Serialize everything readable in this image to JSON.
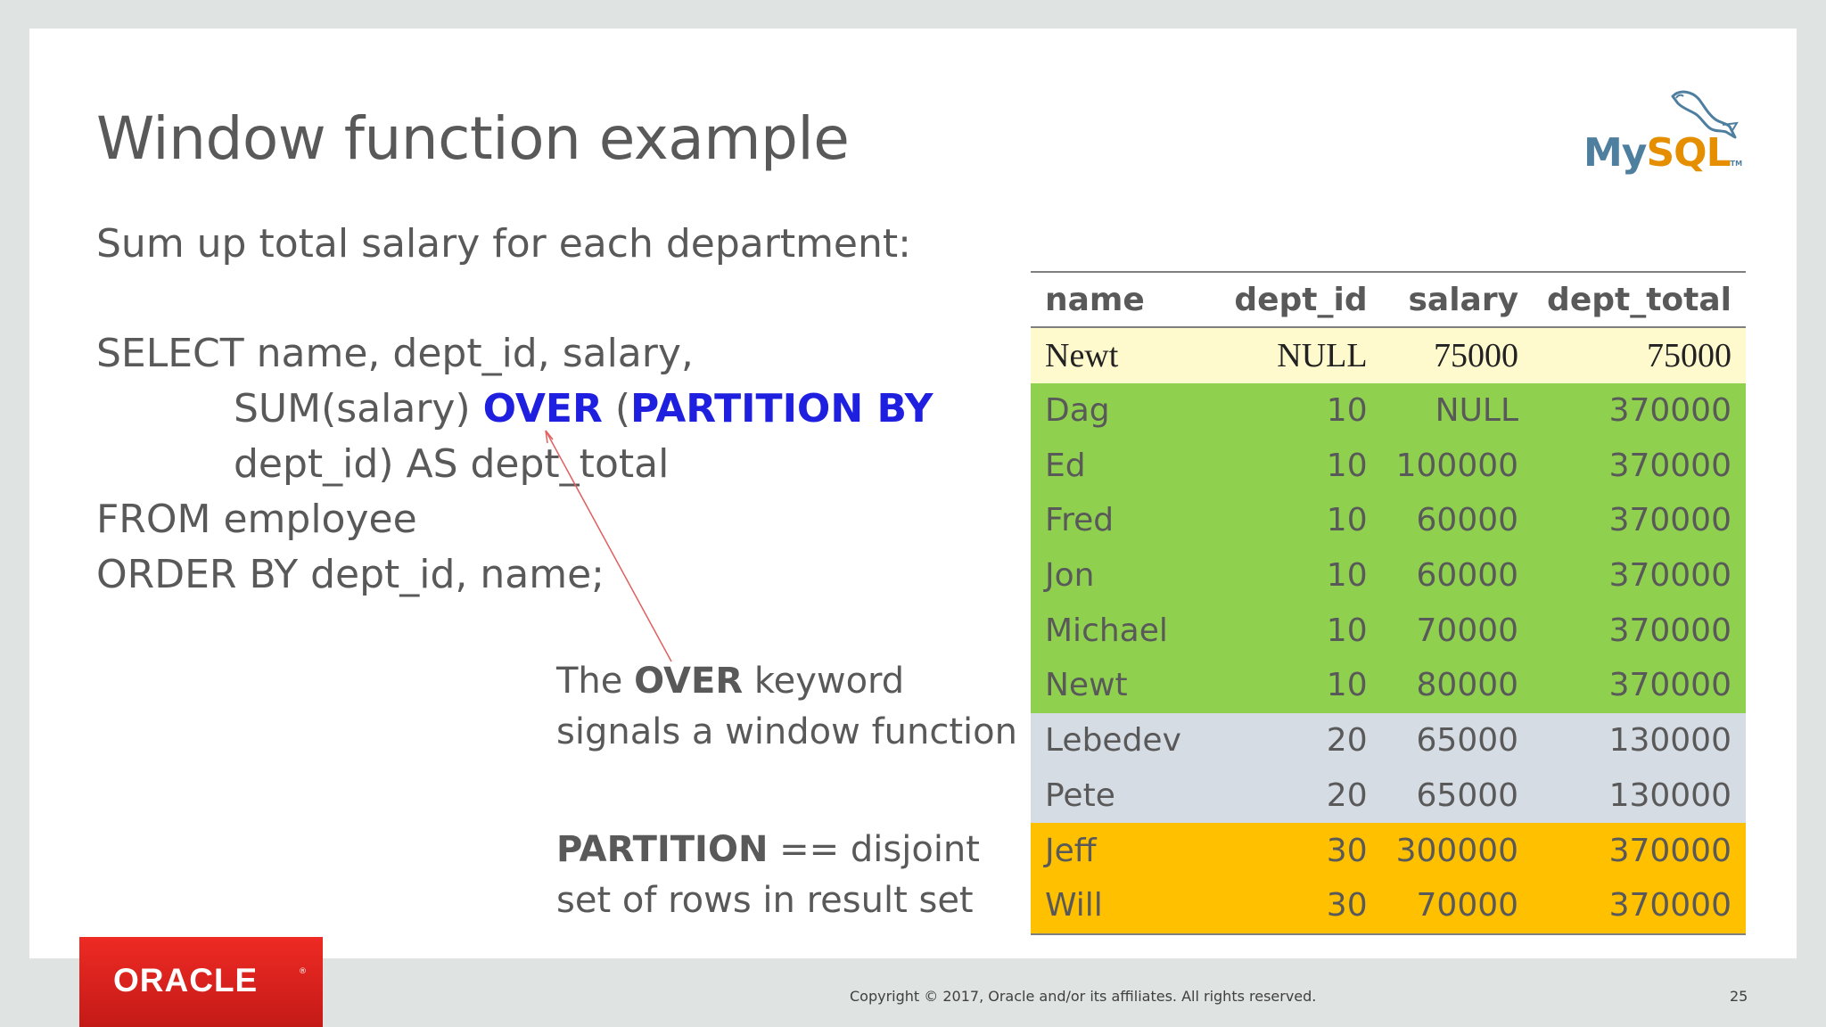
{
  "slide": {
    "title": "Window function example",
    "subtitle": "Sum up total salary for each department:",
    "code": {
      "line1": "SELECT name, dept_id, salary,",
      "line2_pre": "SUM(salary) ",
      "line2_kw1": "OVER",
      "line2_mid": " (",
      "line2_kw2": "PARTITION BY",
      "line3": "dept_id) AS dept_total",
      "line4": "FROM employee",
      "line5": "ORDER BY dept_id, name;"
    },
    "note1": {
      "pre": "The ",
      "bold": "OVER",
      "post": " keyword",
      "line2": "signals a window function"
    },
    "note2": {
      "bold": "PARTITION",
      "post": " == disjoint",
      "line2": "set of rows in result set"
    }
  },
  "logo": {
    "my": "My",
    "sql": "SQL",
    "tm": "TM"
  },
  "table": {
    "columns": [
      "name",
      "dept_id",
      "salary",
      "dept_total"
    ],
    "rows": [
      {
        "group": "yellow",
        "cells": [
          "Newt",
          "NULL",
          "75000",
          "75000"
        ]
      },
      {
        "group": "green",
        "cells": [
          "Dag",
          "10",
          "NULL",
          "370000"
        ]
      },
      {
        "group": "green",
        "cells": [
          "Ed",
          "10",
          "100000",
          "370000"
        ]
      },
      {
        "group": "green",
        "cells": [
          "Fred",
          "10",
          "60000",
          "370000"
        ]
      },
      {
        "group": "green",
        "cells": [
          "Jon",
          "10",
          "60000",
          "370000"
        ]
      },
      {
        "group": "green",
        "cells": [
          "Michael",
          "10",
          "70000",
          "370000"
        ]
      },
      {
        "group": "green",
        "cells": [
          "Newt",
          "10",
          "80000",
          "370000"
        ]
      },
      {
        "group": "grey",
        "cells": [
          "Lebedev",
          "20",
          "65000",
          "130000"
        ]
      },
      {
        "group": "grey",
        "cells": [
          "Pete",
          "20",
          "65000",
          "130000"
        ]
      },
      {
        "group": "orange",
        "cells": [
          "Jeff",
          "30",
          "300000",
          "370000"
        ]
      },
      {
        "group": "orange",
        "cells": [
          "Will",
          "30",
          "70000",
          "370000"
        ]
      }
    ]
  },
  "colors": {
    "keyword": "#1f1fe0",
    "yellow_row": "#fffacd",
    "green_rows": "#8fd14f",
    "grey_rows": "#d6dce4",
    "orange_rows": "#ffc000",
    "oracle_red": "#e02020"
  },
  "footer": {
    "brand": "ORACLE",
    "copyright": "Copyright © 2017, Oracle and/or its affiliates. All rights reserved.",
    "page_number": "25"
  }
}
